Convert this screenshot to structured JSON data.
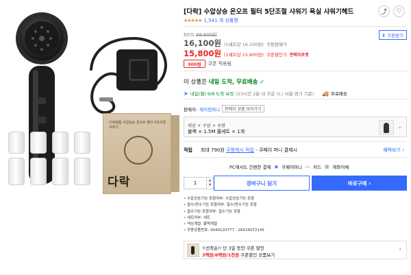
{
  "product": {
    "brand": "[다락]",
    "title": "수압상승 온오프 필터 5단조절 샤워기 욕실 샤워기헤드",
    "rating_stars": "★★★★★",
    "rating_count": "1,541 개 상품평"
  },
  "actions": {
    "share_icon": "share-icon",
    "heart_icon": "heart-icon",
    "coupon_download": "쿠폰받기"
  },
  "pricing": {
    "discount_rate": "60%",
    "original_price": "39,800원",
    "price": "16,100원",
    "price_sub": "(1세트당 16,100원)",
    "price_label": "쿠팡판매가",
    "coupon_price": "15,800원",
    "coupon_price_sub": "(1세트당 15,800원)",
    "coupon_price_label": "쿠폰할인가",
    "seller_badge": "판매자로켓",
    "coupon_amount": "300원",
    "coupon_label": "쿠폰 적용됨"
  },
  "shipping": {
    "title_prefix": "이 상품은",
    "title_highlight": "내일 도착, 무료배송",
    "check": "✓",
    "date_label": "내일(월) 9/8 도착 보장",
    "date_note": "(23시간 2분 내 주문 시 / 서울⋅경기 기준)",
    "free_label": "무료배송"
  },
  "seller": {
    "label": "판매자:",
    "name": "제이컴퍼니",
    "button": "판매자 상품 보러가기"
  },
  "option": {
    "label": "색상 × 구성 × 수량",
    "value": "블랙 × 1.5M 풀세트 × 1개"
  },
  "points": {
    "label": "적립",
    "max": "최대 790원",
    "cash": "쿠팡캐시 적립",
    "money": "- 쿠페이 머니 결제시",
    "benefits": "혜택보기"
  },
  "payment": {
    "intro": "PC에서도 간편한 결제",
    "coupay": "쿠페이머니",
    "card": "카드",
    "account": "계좌이체"
  },
  "purchase": {
    "quantity": "1",
    "cart_button": "장바구니 담기",
    "buy_button": "바로구매"
  },
  "specs": [
    "수압상승기능 포함여부: 수압상승기능 포함",
    "절수/연수기능 포함여부: 절수/연수기능 포함",
    "절수기능 포함여부: 절수기능 포함",
    "세트여부: 세트",
    "색상계열: 블랙계열",
    "쿠팡상품번호: 9040120777 - 26524072145"
  ],
  "promo": {
    "line1": "!!선착순!! 단 3일 동안 쿠폰 할인",
    "line2_red": "3백원/6백원/1천원",
    "line2_rest": "쿠폰할인 상품보기"
  },
  "image": {
    "box_text": "다락정품 수압상승 온오프 필터 5단조절 샤워기",
    "box_brand": "다락"
  },
  "colors": {
    "accent_blue": "#346aff",
    "price_red": "#e52528",
    "ship_green": "#00891a",
    "star_orange": "#f58a1f"
  }
}
